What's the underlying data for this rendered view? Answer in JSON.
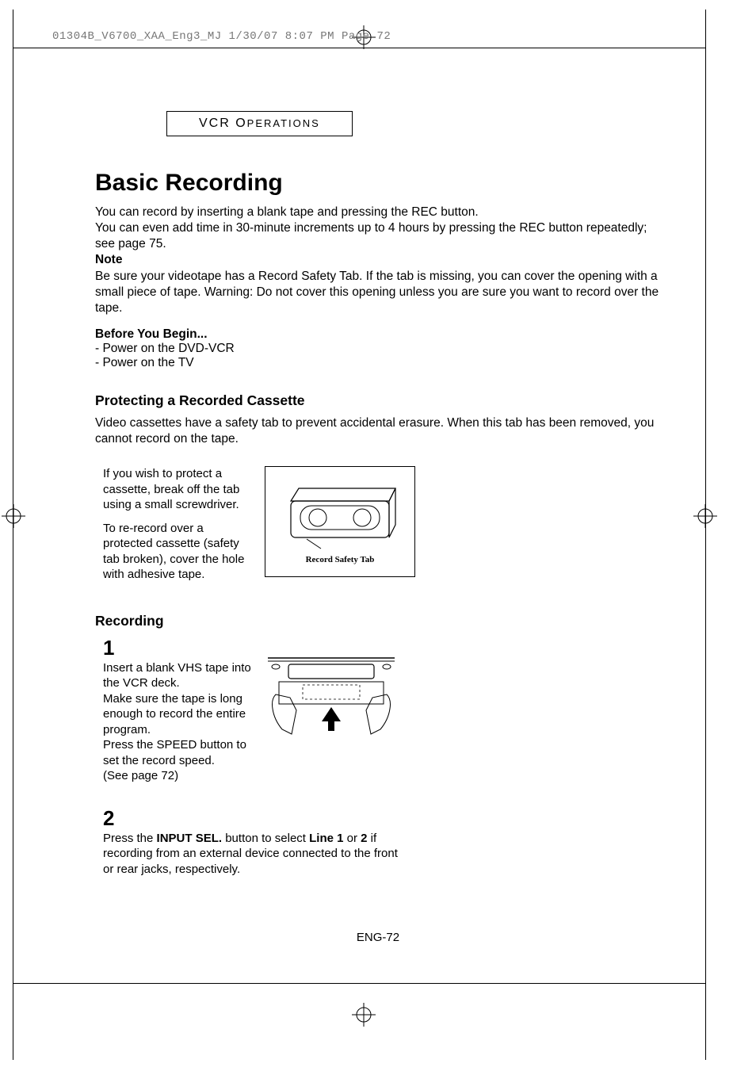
{
  "header_info": "01304B_V6700_XAA_Eng3_MJ  1/30/07  8:07 PM  Page 72",
  "section_label_prefix": "VCR O",
  "section_label_rest": "PERATIONS",
  "title": "Basic Recording",
  "intro": {
    "line1": "You can record by inserting a blank tape and pressing the REC button.",
    "line2": "You can even add time in 30-minute increments up to 4 hours by pressing the REC button repeatedly;",
    "line3": "see page 75.",
    "note_label": "Note",
    "note_body": "Be sure your videotape has a Record Safety Tab.  If the tab is missing, you can cover the opening with a small piece of tape. Warning: Do not cover this opening unless you are sure you want to record over the tape."
  },
  "before": {
    "heading_strong": "Before",
    "heading_rest": " You Begin...",
    "b1": "-   Power on the DVD-VCR",
    "b2": "-   Power on the TV"
  },
  "protect": {
    "heading": "Protecting a Recorded Cassette",
    "body": "Video cassettes have a safety tab to prevent accidental erasure. When this tab has been removed, you cannot record on the tape.",
    "col_p1": "If you wish to protect a cassette, break off the tab using a small screwdriver.",
    "col_p2": "To re-record over a protected cassette (safety tab broken), cover the hole with adhesive tape.",
    "figure_caption": "Record Safety Tab"
  },
  "recording": {
    "heading": "Recording",
    "step1": {
      "num": "1",
      "l1": "Insert a blank VHS tape into the VCR deck.",
      "l2": "Make sure the tape is long enough to record the entire program.",
      "l3": "Press the SPEED button to set the record speed.",
      "l4": "(See page 72)"
    },
    "step2": {
      "num": "2",
      "t_pre": "Press the ",
      "t_b1": "INPUT SEL.",
      "t_mid": " button to select ",
      "t_b2": "Line 1",
      "t_or": " or ",
      "t_b3": "2",
      "t_rest": " if recording from an external device connected to the front or rear jacks, respectively."
    }
  },
  "page_number": "ENG-72"
}
